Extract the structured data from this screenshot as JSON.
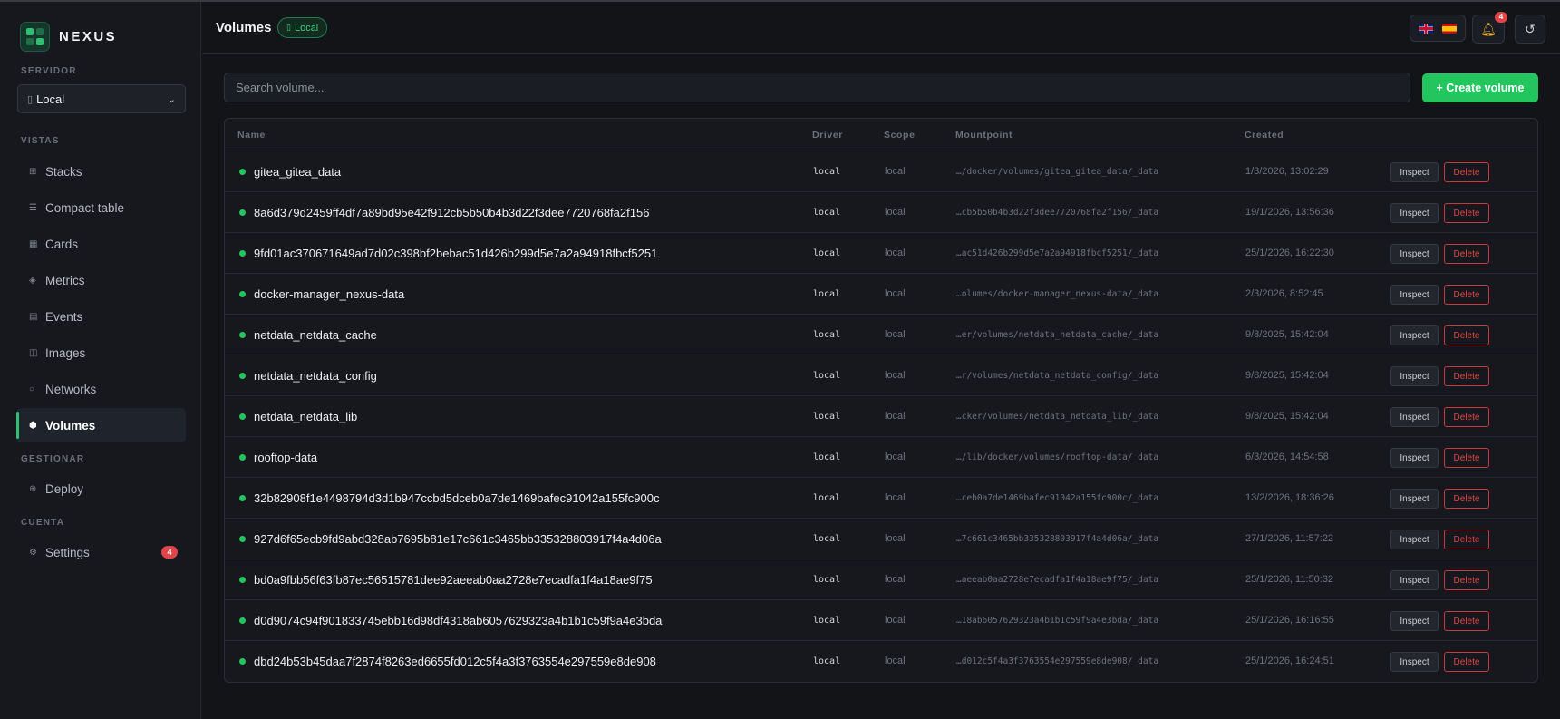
{
  "app": {
    "brand": "NEXUS"
  },
  "sidebar": {
    "server_label": "SERVIDOR",
    "server_value": "Local",
    "views_label": "VISTAS",
    "manage_label": "GESTIONAR",
    "account_label": "CUENTA",
    "items": [
      {
        "label": "Stacks",
        "icon": "grid-icon"
      },
      {
        "label": "Compact table",
        "icon": "list-icon"
      },
      {
        "label": "Cards",
        "icon": "cards-icon"
      },
      {
        "label": "Metrics",
        "icon": "diamond-icon"
      },
      {
        "label": "Events",
        "icon": "events-icon"
      },
      {
        "label": "Images",
        "icon": "images-icon"
      },
      {
        "label": "Networks",
        "icon": "network-icon"
      },
      {
        "label": "Volumes",
        "icon": "volume-icon",
        "active": true
      }
    ],
    "manage_items": [
      {
        "label": "Deploy",
        "icon": "deploy-icon"
      }
    ],
    "account_items": [
      {
        "label": "Settings",
        "icon": "gear-icon",
        "badge": "4"
      }
    ]
  },
  "header": {
    "title": "Volumes",
    "env_badge": "Local",
    "notifications_count": "4",
    "colors": {
      "accent": "#22c55e",
      "danger": "#e0454a"
    }
  },
  "search": {
    "placeholder": "Search volume..."
  },
  "create_button": "+ Create volume",
  "table": {
    "columns": {
      "name": "Name",
      "driver": "Driver",
      "scope": "Scope",
      "mountpoint": "Mountpoint",
      "created": "Created"
    },
    "inspect_label": "Inspect",
    "delete_label": "Delete",
    "rows": [
      {
        "name": "gitea_gitea_data",
        "driver": "local",
        "scope": "local",
        "mountpoint": "…/docker/volumes/gitea_gitea_data/_data",
        "created": "1/3/2026, 13:02:29"
      },
      {
        "name": "8a6d379d2459ff4df7a89bd95e42f912cb5b50b4b3d22f3dee7720768fa2f156",
        "driver": "local",
        "scope": "local",
        "mountpoint": "…cb5b50b4b3d22f3dee7720768fa2f156/_data",
        "created": "19/1/2026, 13:56:36"
      },
      {
        "name": "9fd01ac370671649ad7d02c398bf2bebac51d426b299d5e7a2a94918fbcf5251",
        "driver": "local",
        "scope": "local",
        "mountpoint": "…ac51d426b299d5e7a2a94918fbcf5251/_data",
        "created": "25/1/2026, 16:22:30"
      },
      {
        "name": "docker-manager_nexus-data",
        "driver": "local",
        "scope": "local",
        "mountpoint": "…olumes/docker-manager_nexus-data/_data",
        "created": "2/3/2026, 8:52:45"
      },
      {
        "name": "netdata_netdata_cache",
        "driver": "local",
        "scope": "local",
        "mountpoint": "…er/volumes/netdata_netdata_cache/_data",
        "created": "9/8/2025, 15:42:04"
      },
      {
        "name": "netdata_netdata_config",
        "driver": "local",
        "scope": "local",
        "mountpoint": "…r/volumes/netdata_netdata_config/_data",
        "created": "9/8/2025, 15:42:04"
      },
      {
        "name": "netdata_netdata_lib",
        "driver": "local",
        "scope": "local",
        "mountpoint": "…cker/volumes/netdata_netdata_lib/_data",
        "created": "9/8/2025, 15:42:04"
      },
      {
        "name": "rooftop-data",
        "driver": "local",
        "scope": "local",
        "mountpoint": "…/lib/docker/volumes/rooftop-data/_data",
        "created": "6/3/2026, 14:54:58"
      },
      {
        "name": "32b82908f1e4498794d3d1b947ccbd5dceb0a7de1469bafec91042a155fc900c",
        "driver": "local",
        "scope": "local",
        "mountpoint": "…ceb0a7de1469bafec91042a155fc900c/_data",
        "created": "13/2/2026, 18:36:26"
      },
      {
        "name": "927d6f65ecb9fd9abd328ab7695b81e17c661c3465bb335328803917f4a4d06a",
        "driver": "local",
        "scope": "local",
        "mountpoint": "…7c661c3465bb335328803917f4a4d06a/_data",
        "created": "27/1/2026, 11:57:22"
      },
      {
        "name": "bd0a9fbb56f63fb87ec56515781dee92aeeab0aa2728e7ecadfa1f4a18ae9f75",
        "driver": "local",
        "scope": "local",
        "mountpoint": "…aeeab0aa2728e7ecadfa1f4a18ae9f75/_data",
        "created": "25/1/2026, 11:50:32"
      },
      {
        "name": "d0d9074c94f901833745ebb16d98df4318ab6057629323a4b1b1c59f9a4e3bda",
        "driver": "local",
        "scope": "local",
        "mountpoint": "…18ab6057629323a4b1b1c59f9a4e3bda/_data",
        "created": "25/1/2026, 16:16:55"
      },
      {
        "name": "dbd24b53b45daa7f2874f8263ed6655fd012c5f4a3f3763554e297559e8de908",
        "driver": "local",
        "scope": "local",
        "mountpoint": "…d012c5f4a3f3763554e297559e8de908/_data",
        "created": "25/1/2026, 16:24:51"
      }
    ]
  }
}
